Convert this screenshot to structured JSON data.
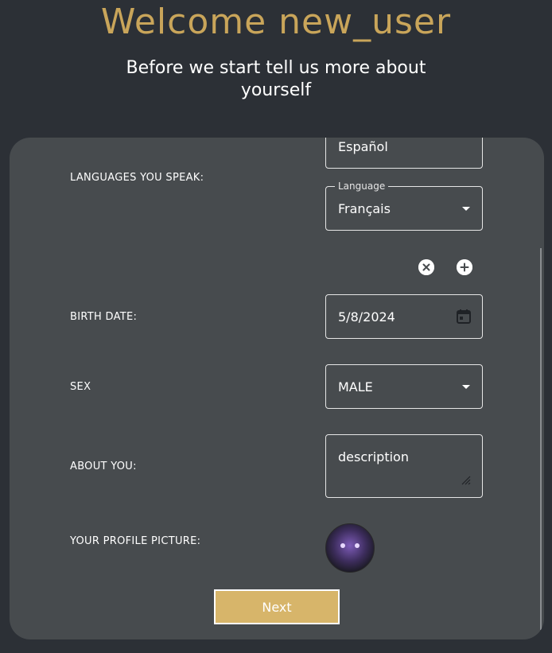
{
  "header": {
    "title": "Welcome new_user",
    "subtitle": "Before we start tell us more about yourself"
  },
  "form": {
    "languages": {
      "label": "LANGUAGES YOU SPEAK:",
      "first_value_partial": "Español",
      "second_legend": "Language",
      "second_value": "Français",
      "remove_icon": "close-circle-icon",
      "add_icon": "plus-circle-icon"
    },
    "birth_date": {
      "label": "BIRTH DATE:",
      "value": "5/8/2024",
      "icon": "calendar-icon"
    },
    "sex": {
      "label": "SEX",
      "value": "MALE"
    },
    "about": {
      "label": "ABOUT YOU:",
      "value": "description"
    },
    "profile_picture": {
      "label": "YOUR PROFILE PICTURE:"
    },
    "next_label": "Next"
  },
  "colors": {
    "background": "#2c3036",
    "card": "#474b4e",
    "accent": "#c9a55a",
    "button": "#d7b56a"
  }
}
